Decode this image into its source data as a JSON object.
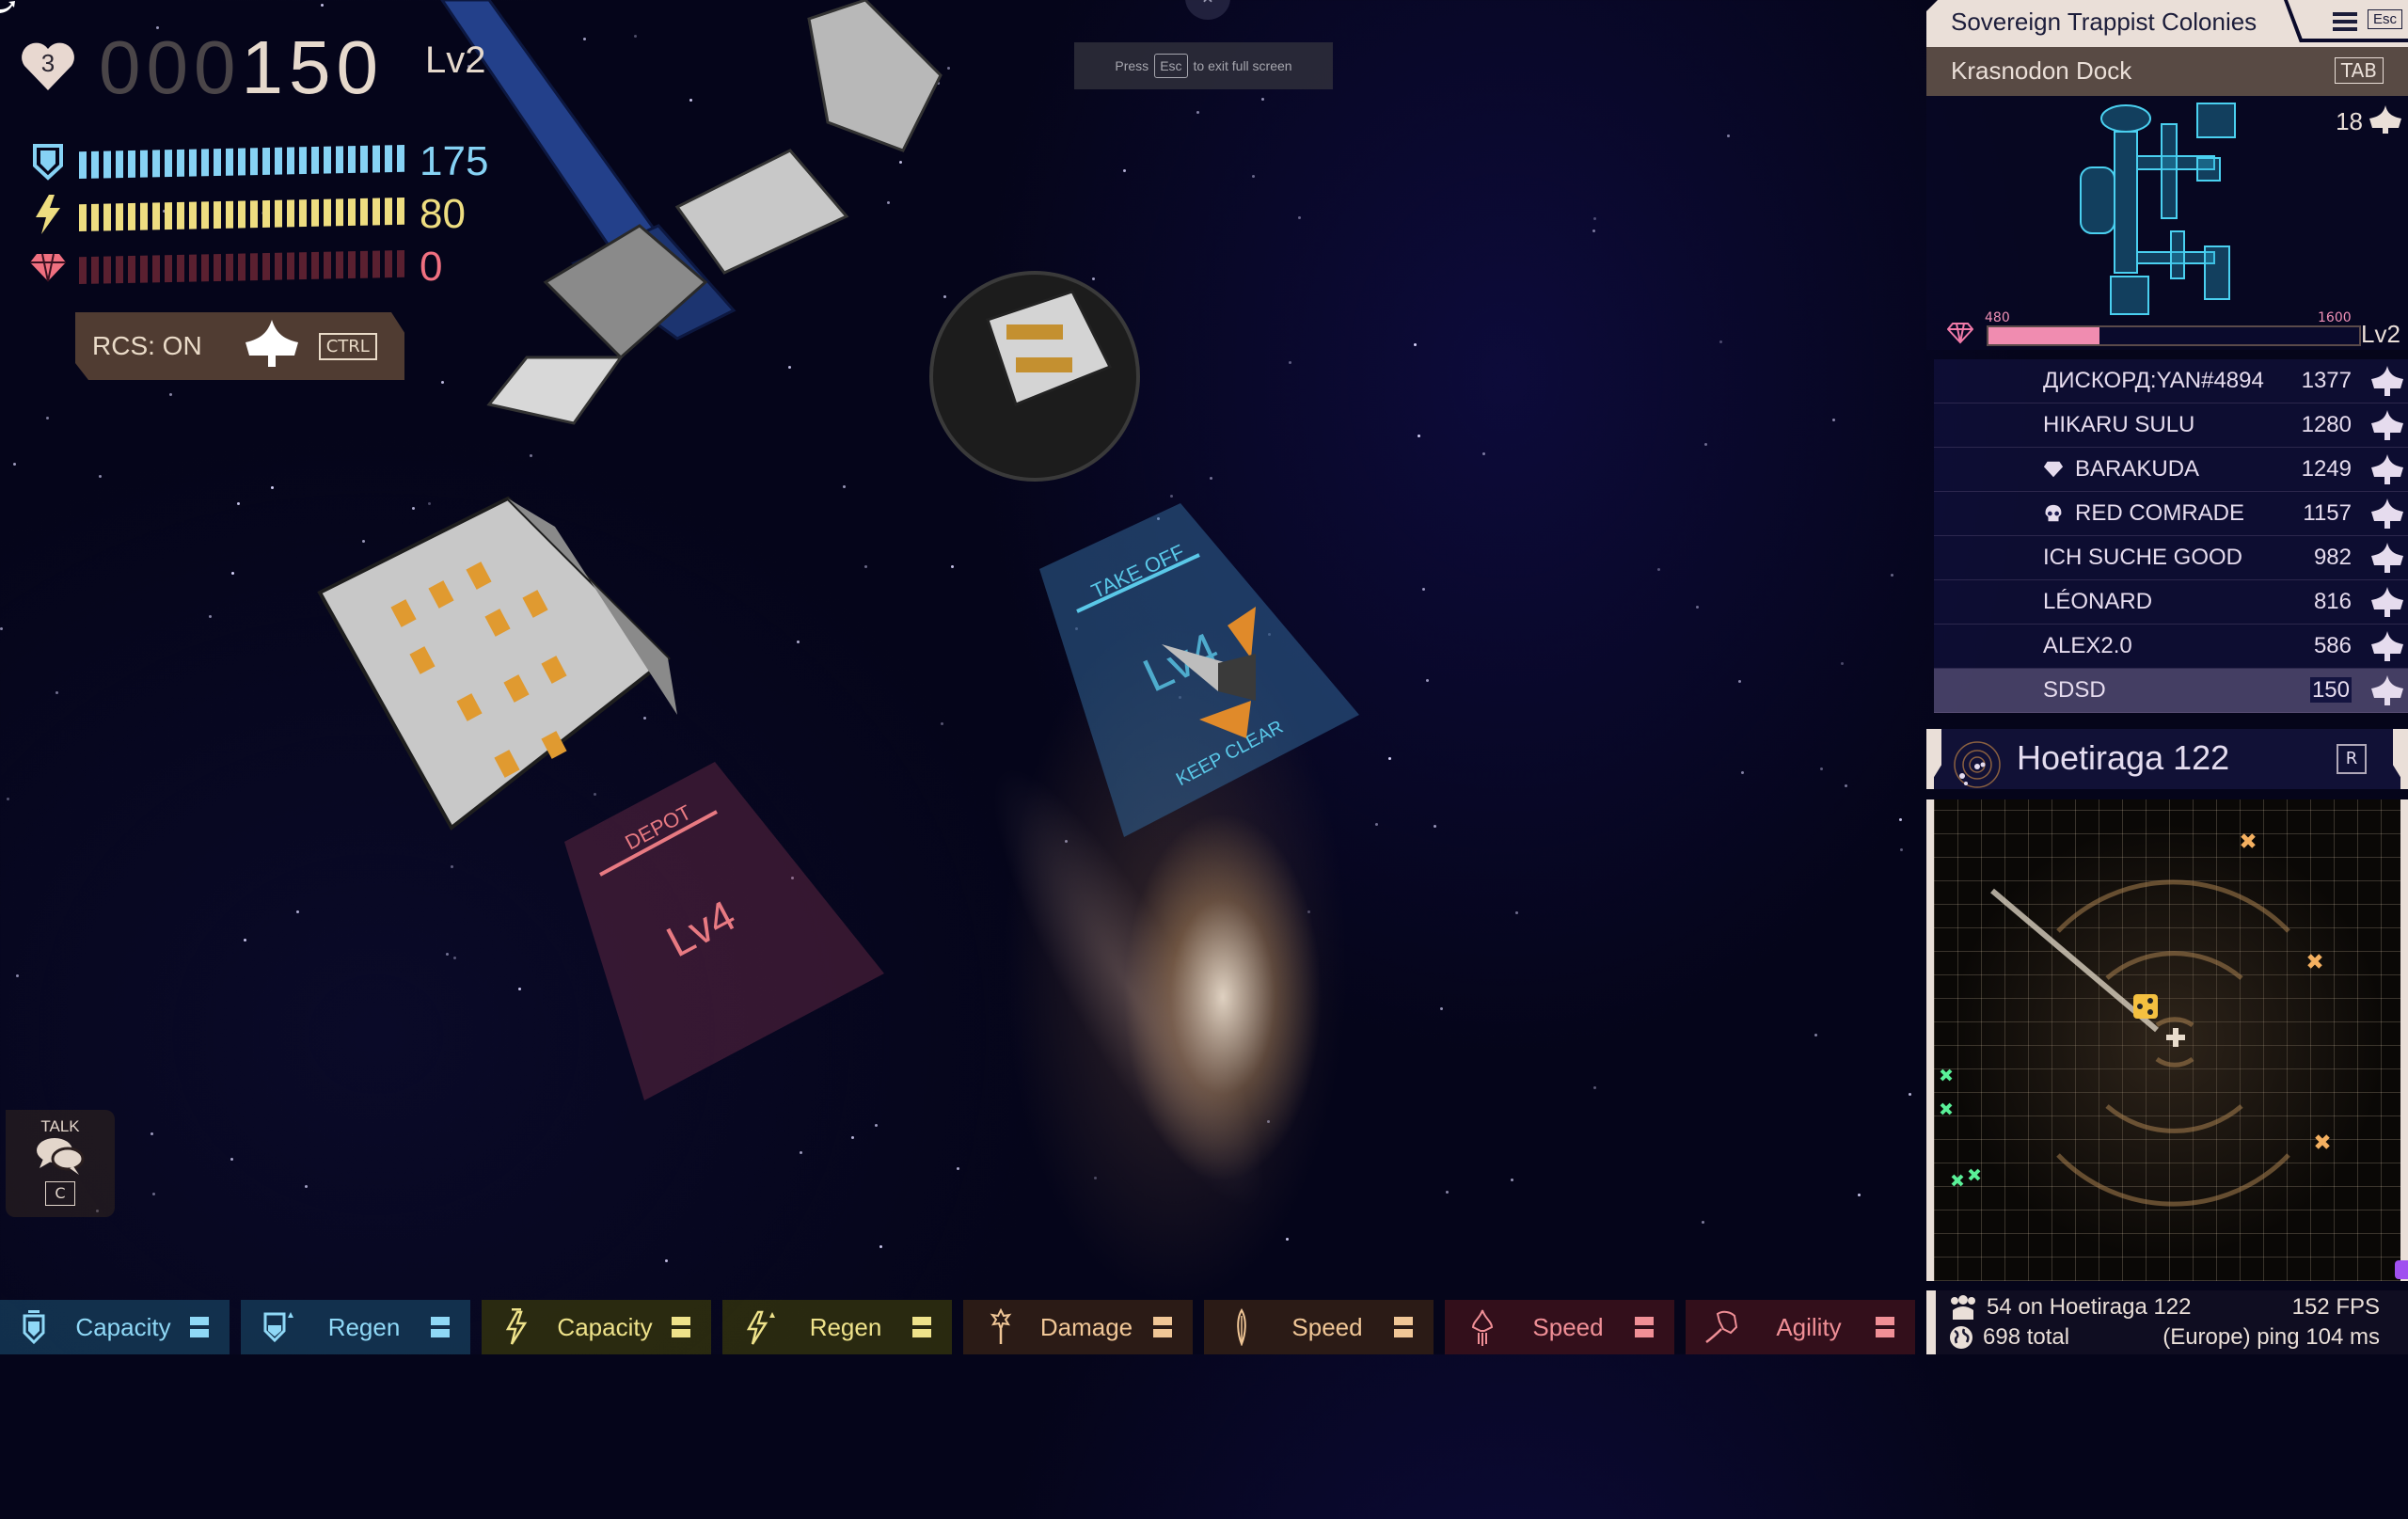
{
  "hud": {
    "lives": "3",
    "score_dim": "000",
    "score_lit": "150",
    "level": "Lv2",
    "shield": {
      "value": "175",
      "color": "#86d2f4",
      "fill": 1.0
    },
    "energy": {
      "value": "80",
      "color": "#eedd80",
      "fill": 1.0
    },
    "gems": {
      "value": "0",
      "color": "#f07080",
      "fill": 0.0
    },
    "rcs_label": "RCS: ON",
    "rcs_key": "CTRL"
  },
  "world": {
    "takeoff_pad": {
      "title": "TAKE OFF",
      "level": "Lv4",
      "footer": "KEEP CLEAR"
    },
    "depot_pad": {
      "title": "DEPOT",
      "level": "Lv4"
    }
  },
  "fullscreen_notice": {
    "prefix": "Press",
    "key": "Esc",
    "suffix": "to exit full screen"
  },
  "talk": {
    "label": "TALK",
    "key": "C"
  },
  "upgrades": [
    {
      "group": "shield",
      "icon": "shield-capacity-icon",
      "label": "Capacity"
    },
    {
      "group": "shield",
      "icon": "shield-regen-icon",
      "label": "Regen"
    },
    {
      "group": "energy",
      "icon": "energy-capacity-icon",
      "label": "Capacity"
    },
    {
      "group": "energy",
      "icon": "energy-regen-icon",
      "label": "Regen"
    },
    {
      "group": "weapon",
      "icon": "weapon-damage-icon",
      "label": "Damage"
    },
    {
      "group": "weapon",
      "icon": "weapon-speed-icon",
      "label": "Speed"
    },
    {
      "group": "ship",
      "icon": "ship-speed-icon",
      "label": "Speed"
    },
    {
      "group": "ship",
      "icon": "ship-agility-icon",
      "label": "Agility"
    }
  ],
  "panel": {
    "faction": "Sovereign Trappist Colonies",
    "esc_key": "Esc",
    "station": "Krasnodon Dock",
    "station_key": "TAB",
    "docked_count": "18",
    "xp_min": "480",
    "xp_max": "1600",
    "xp_progress": 0.3,
    "xp_level": "Lv2",
    "leaderboard": [
      {
        "name": "ДИСКОРД:YAN#4894",
        "score": "1377",
        "badge": null,
        "ship": "fighter",
        "me": false
      },
      {
        "name": "HIKARU SULU",
        "score": "1280",
        "badge": null,
        "ship": "twin",
        "me": false
      },
      {
        "name": "BARAKUDA",
        "score": "1249",
        "badge": "gem",
        "ship": "fighter",
        "me": false
      },
      {
        "name": "RED COMRADE",
        "score": "1157",
        "badge": "skull",
        "ship": "heavy",
        "me": false
      },
      {
        "name": "ICH SUCHE  GOOD",
        "score": "982",
        "badge": null,
        "ship": "cruiser",
        "me": false
      },
      {
        "name": "LÉONARD",
        "score": "816",
        "badge": null,
        "ship": "fighter",
        "me": false
      },
      {
        "name": "ALEX2.0",
        "score": "586",
        "badge": null,
        "ship": "twin",
        "me": false
      },
      {
        "name": "SDSD",
        "score": "150",
        "badge": null,
        "ship": "scout",
        "me": true
      }
    ],
    "system": {
      "name": "Hoetiraga 122",
      "key": "R"
    },
    "status": {
      "players_here": "54 on Hoetiraga 122",
      "fps": "152 FPS",
      "total": "698 total",
      "region_ping": "(Europe) ping 104 ms"
    }
  }
}
